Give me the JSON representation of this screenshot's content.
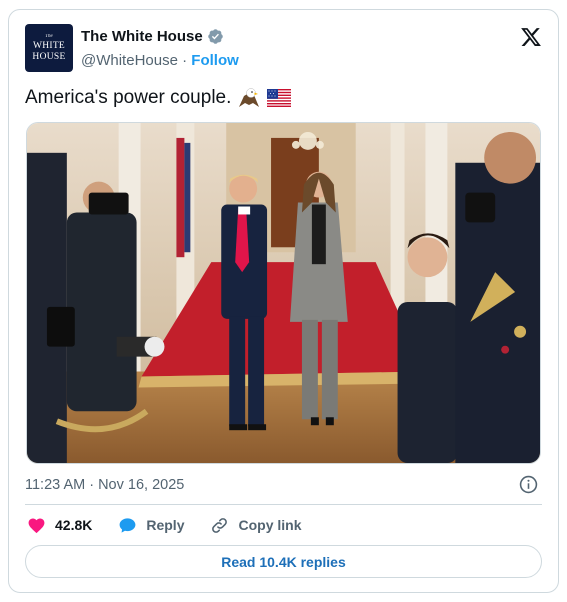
{
  "account": {
    "avatar_line1": "WHITE",
    "avatar_line2": "HOUSE",
    "avatar_top": "The",
    "display_name": "The White House",
    "handle": "@WhiteHouse",
    "separator": "·",
    "follow_label": "Follow",
    "verified_icon": "verified-badge-icon",
    "verified_color": "#829aab"
  },
  "brand_icon": "x-logo-icon",
  "tweet": {
    "text": "America's power couple.",
    "emojis": [
      "eagle",
      "us-flag"
    ],
    "image_alt": "Photo of a man in a navy suit and red tie and a woman in a grey suit walking down a red-carpeted hallway lined with photographers and uniformed military members"
  },
  "meta": {
    "timestamp": "11:23 AM · Nov 16, 2025",
    "info_icon": "info-icon"
  },
  "actions": {
    "like_icon": "heart-icon",
    "like_count": "42.8K",
    "like_color": "#f91880",
    "reply_icon": "speech-bubble-icon",
    "reply_label": "Reply",
    "reply_color": "#1d9bf0",
    "copy_icon": "link-icon",
    "copy_label": "Copy link"
  },
  "footer": {
    "read_replies_label": "Read 10.4K replies"
  },
  "colors": {
    "accent": "#1d9bf0",
    "text_secondary": "#536471",
    "border": "#cfd9de"
  }
}
